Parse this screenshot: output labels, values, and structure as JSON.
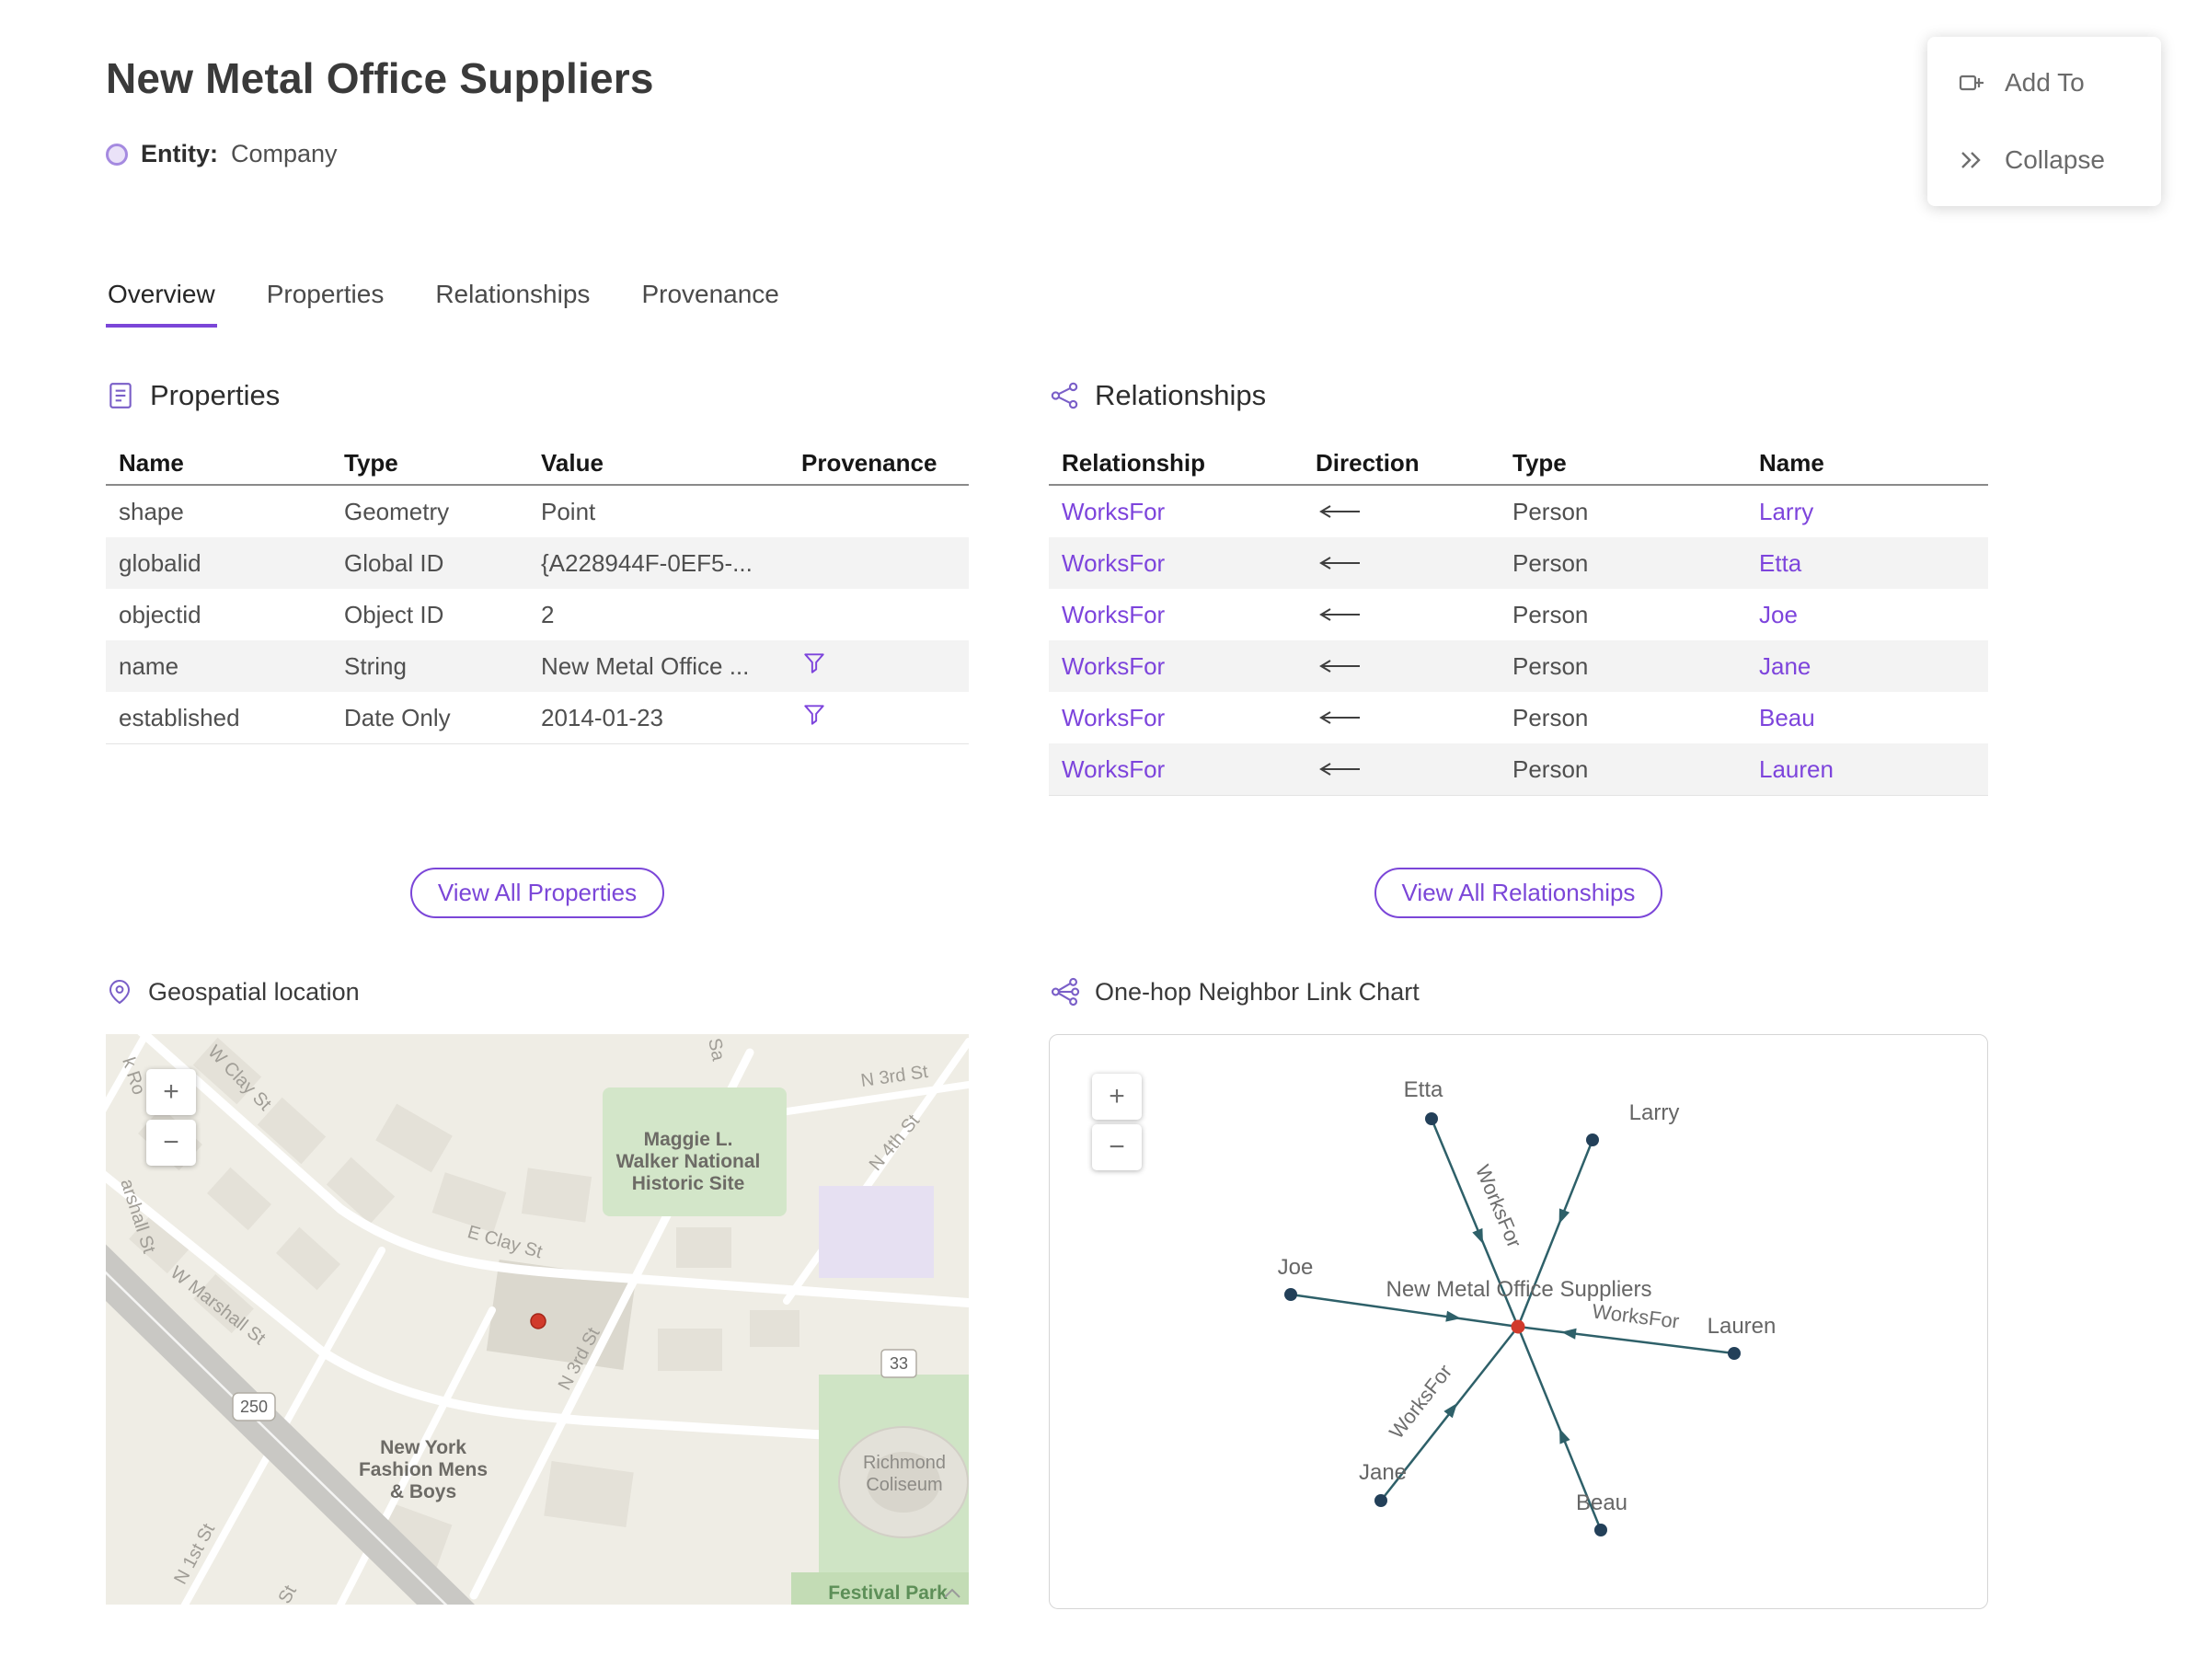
{
  "header": {
    "title": "New Metal Office Suppliers",
    "entity_label": "Entity:",
    "entity_type": "Company"
  },
  "action_panel": {
    "add_to": "Add To",
    "collapse": "Collapse"
  },
  "tabs": [
    {
      "label": "Overview",
      "active": true
    },
    {
      "label": "Properties",
      "active": false
    },
    {
      "label": "Relationships",
      "active": false
    },
    {
      "label": "Provenance",
      "active": false
    }
  ],
  "properties_section": {
    "title": "Properties",
    "columns": [
      "Name",
      "Type",
      "Value",
      "Provenance"
    ],
    "rows": [
      {
        "name": "shape",
        "type": "Geometry",
        "value": "Point",
        "has_provenance": false
      },
      {
        "name": "globalid",
        "type": "Global ID",
        "value": "{A228944F-0EF5-...",
        "has_provenance": false
      },
      {
        "name": "objectid",
        "type": "Object ID",
        "value": "2",
        "has_provenance": false
      },
      {
        "name": "name",
        "type": "String",
        "value": "New Metal Office ...",
        "has_provenance": true
      },
      {
        "name": "established",
        "type": "Date Only",
        "value": "2014-01-23",
        "has_provenance": true
      }
    ],
    "view_all_label": "View All Properties"
  },
  "relationships_section": {
    "title": "Relationships",
    "columns": [
      "Relationship",
      "Direction",
      "Type",
      "Name"
    ],
    "rows": [
      {
        "relationship": "WorksFor",
        "direction": "←",
        "type": "Person",
        "name": "Larry"
      },
      {
        "relationship": "WorksFor",
        "direction": "←",
        "type": "Person",
        "name": "Etta"
      },
      {
        "relationship": "WorksFor",
        "direction": "←",
        "type": "Person",
        "name": "Joe"
      },
      {
        "relationship": "WorksFor",
        "direction": "←",
        "type": "Person",
        "name": "Jane"
      },
      {
        "relationship": "WorksFor",
        "direction": "←",
        "type": "Person",
        "name": "Beau"
      },
      {
        "relationship": "WorksFor",
        "direction": "←",
        "type": "Person",
        "name": "Lauren"
      }
    ],
    "view_all_label": "View All Relationships"
  },
  "map_section": {
    "title": "Geospatial location",
    "zoom_in": "+",
    "zoom_out": "−",
    "labels": {
      "brook_rd": "k Ro",
      "w_clay": "W Clay St",
      "sa": "Sa",
      "n3rd_top": "N 3rd St",
      "n4th": "N 4th St",
      "maggie1": "Maggie L.",
      "maggie2": "Walker National",
      "maggie3": "Historic Site",
      "e_clay": "E Clay St",
      "marshall_left": "arshall St",
      "w_marshall": "W Marshall St",
      "n3rd_mid": "N 3rd St",
      "shield_250": "250",
      "shield_33": "33",
      "ny1": "New York",
      "ny2": "Fashion Mens",
      "ny3": "& Boys",
      "coliseum1": "Richmond",
      "coliseum2": "Coliseum",
      "n1st": "N 1st St",
      "st_partial": "St",
      "festival": "Festival Park"
    }
  },
  "link_chart_section": {
    "title": "One-hop Neighbor Link Chart",
    "zoom_in": "+",
    "zoom_out": "−",
    "center_label": "New Metal Office Suppliers",
    "edge_label": "WorksFor",
    "nodes": [
      {
        "name": "Etta"
      },
      {
        "name": "Larry"
      },
      {
        "name": "Joe"
      },
      {
        "name": "Lauren"
      },
      {
        "name": "Jane"
      },
      {
        "name": "Beau"
      }
    ]
  },
  "colors": {
    "accent_purple": "#7b46d8",
    "link_purple": "#7d44dc",
    "edge_teal": "#2e6069",
    "node_navy": "#234059",
    "center_red": "#d13a2b",
    "stripe_gray": "#f3f3f3"
  }
}
